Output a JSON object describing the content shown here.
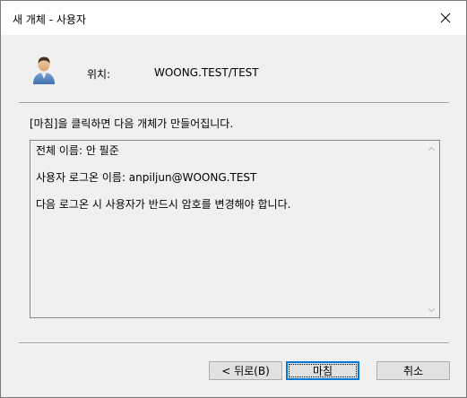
{
  "window": {
    "title": "새 개체 - 사용자"
  },
  "location": {
    "label": "위치:",
    "value": "WOONG.TEST/TEST"
  },
  "instruction": "[마침]을 클릭하면 다음 개체가 만들어집니다.",
  "summary": {
    "lines": [
      "전체 이름: 안 필준",
      "사용자 로그온 이름: anpiljun@WOONG.TEST",
      "다음 로그온 시 사용자가 반드시 암호를 변경해야 합니다."
    ]
  },
  "buttons": {
    "back": "< 뒤로(B)",
    "finish": "마침",
    "cancel": "취소"
  },
  "colors": {
    "focus_border": "#0078d7",
    "dialog_bg": "#f0f0f0",
    "button_bg": "#e1e1e1"
  },
  "icons": {
    "close": "close-icon",
    "user": "user-icon",
    "scroll_up": "scroll-up-arrow-icon",
    "scroll_down": "scroll-down-arrow-icon"
  }
}
